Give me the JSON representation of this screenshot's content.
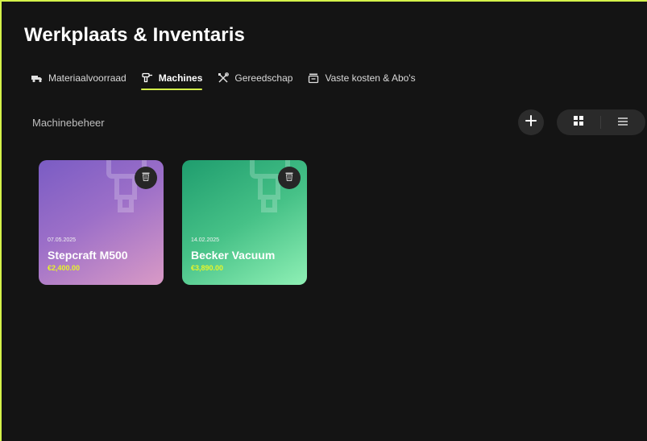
{
  "header": {
    "title": "Werkplaats & Inventaris"
  },
  "tabs": [
    {
      "label": "Materiaalvoorraad",
      "icon": "truck-icon",
      "active": false
    },
    {
      "label": "Machines",
      "icon": "drill-icon",
      "active": true
    },
    {
      "label": "Gereedschap",
      "icon": "tools-icon",
      "active": false
    },
    {
      "label": "Vaste kosten & Abo's",
      "icon": "box-icon",
      "active": false
    }
  ],
  "section": {
    "label": "Machinebeheer"
  },
  "machines": [
    {
      "date": "07.05.2025",
      "name": "Stepcraft M500",
      "price": "€2,400.00"
    },
    {
      "date": "14.02.2025",
      "name": "Becker Vacuum",
      "price": "€3,890.00"
    }
  ],
  "colors": {
    "accent": "#d4f24a",
    "price": "#e6f52a",
    "background": "#141414"
  }
}
